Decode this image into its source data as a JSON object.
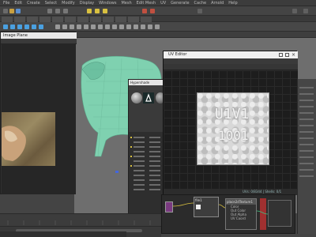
{
  "app": {
    "menu": [
      "File",
      "Edit",
      "Create",
      "Select",
      "Modify",
      "Display",
      "Windows",
      "Mesh",
      "Edit Mesh",
      "UV",
      "Generate",
      "Cache",
      "Arnold",
      "Help"
    ]
  },
  "image_window": {
    "title": "Image Plane"
  },
  "hypershade": {
    "title": "Hypershade"
  },
  "uv_editor": {
    "title": "UV Editor",
    "tile_text_line1": "U1V1",
    "tile_text_line2": "1001",
    "status": "UVs: 0/8344 | Shells: 0/1"
  },
  "node_editor": {
    "node1": "file1",
    "node2": "place2dTexture1",
    "attr1": "Color",
    "attr2": "Out Color",
    "attr3": "Out Alpha",
    "attr4": "UV Coord"
  },
  "colors": {
    "model_tint": "#7fd1b0",
    "accent_blue": "#4aa0e0",
    "node_magenta": "#b04080",
    "node_red": "#a03030"
  }
}
